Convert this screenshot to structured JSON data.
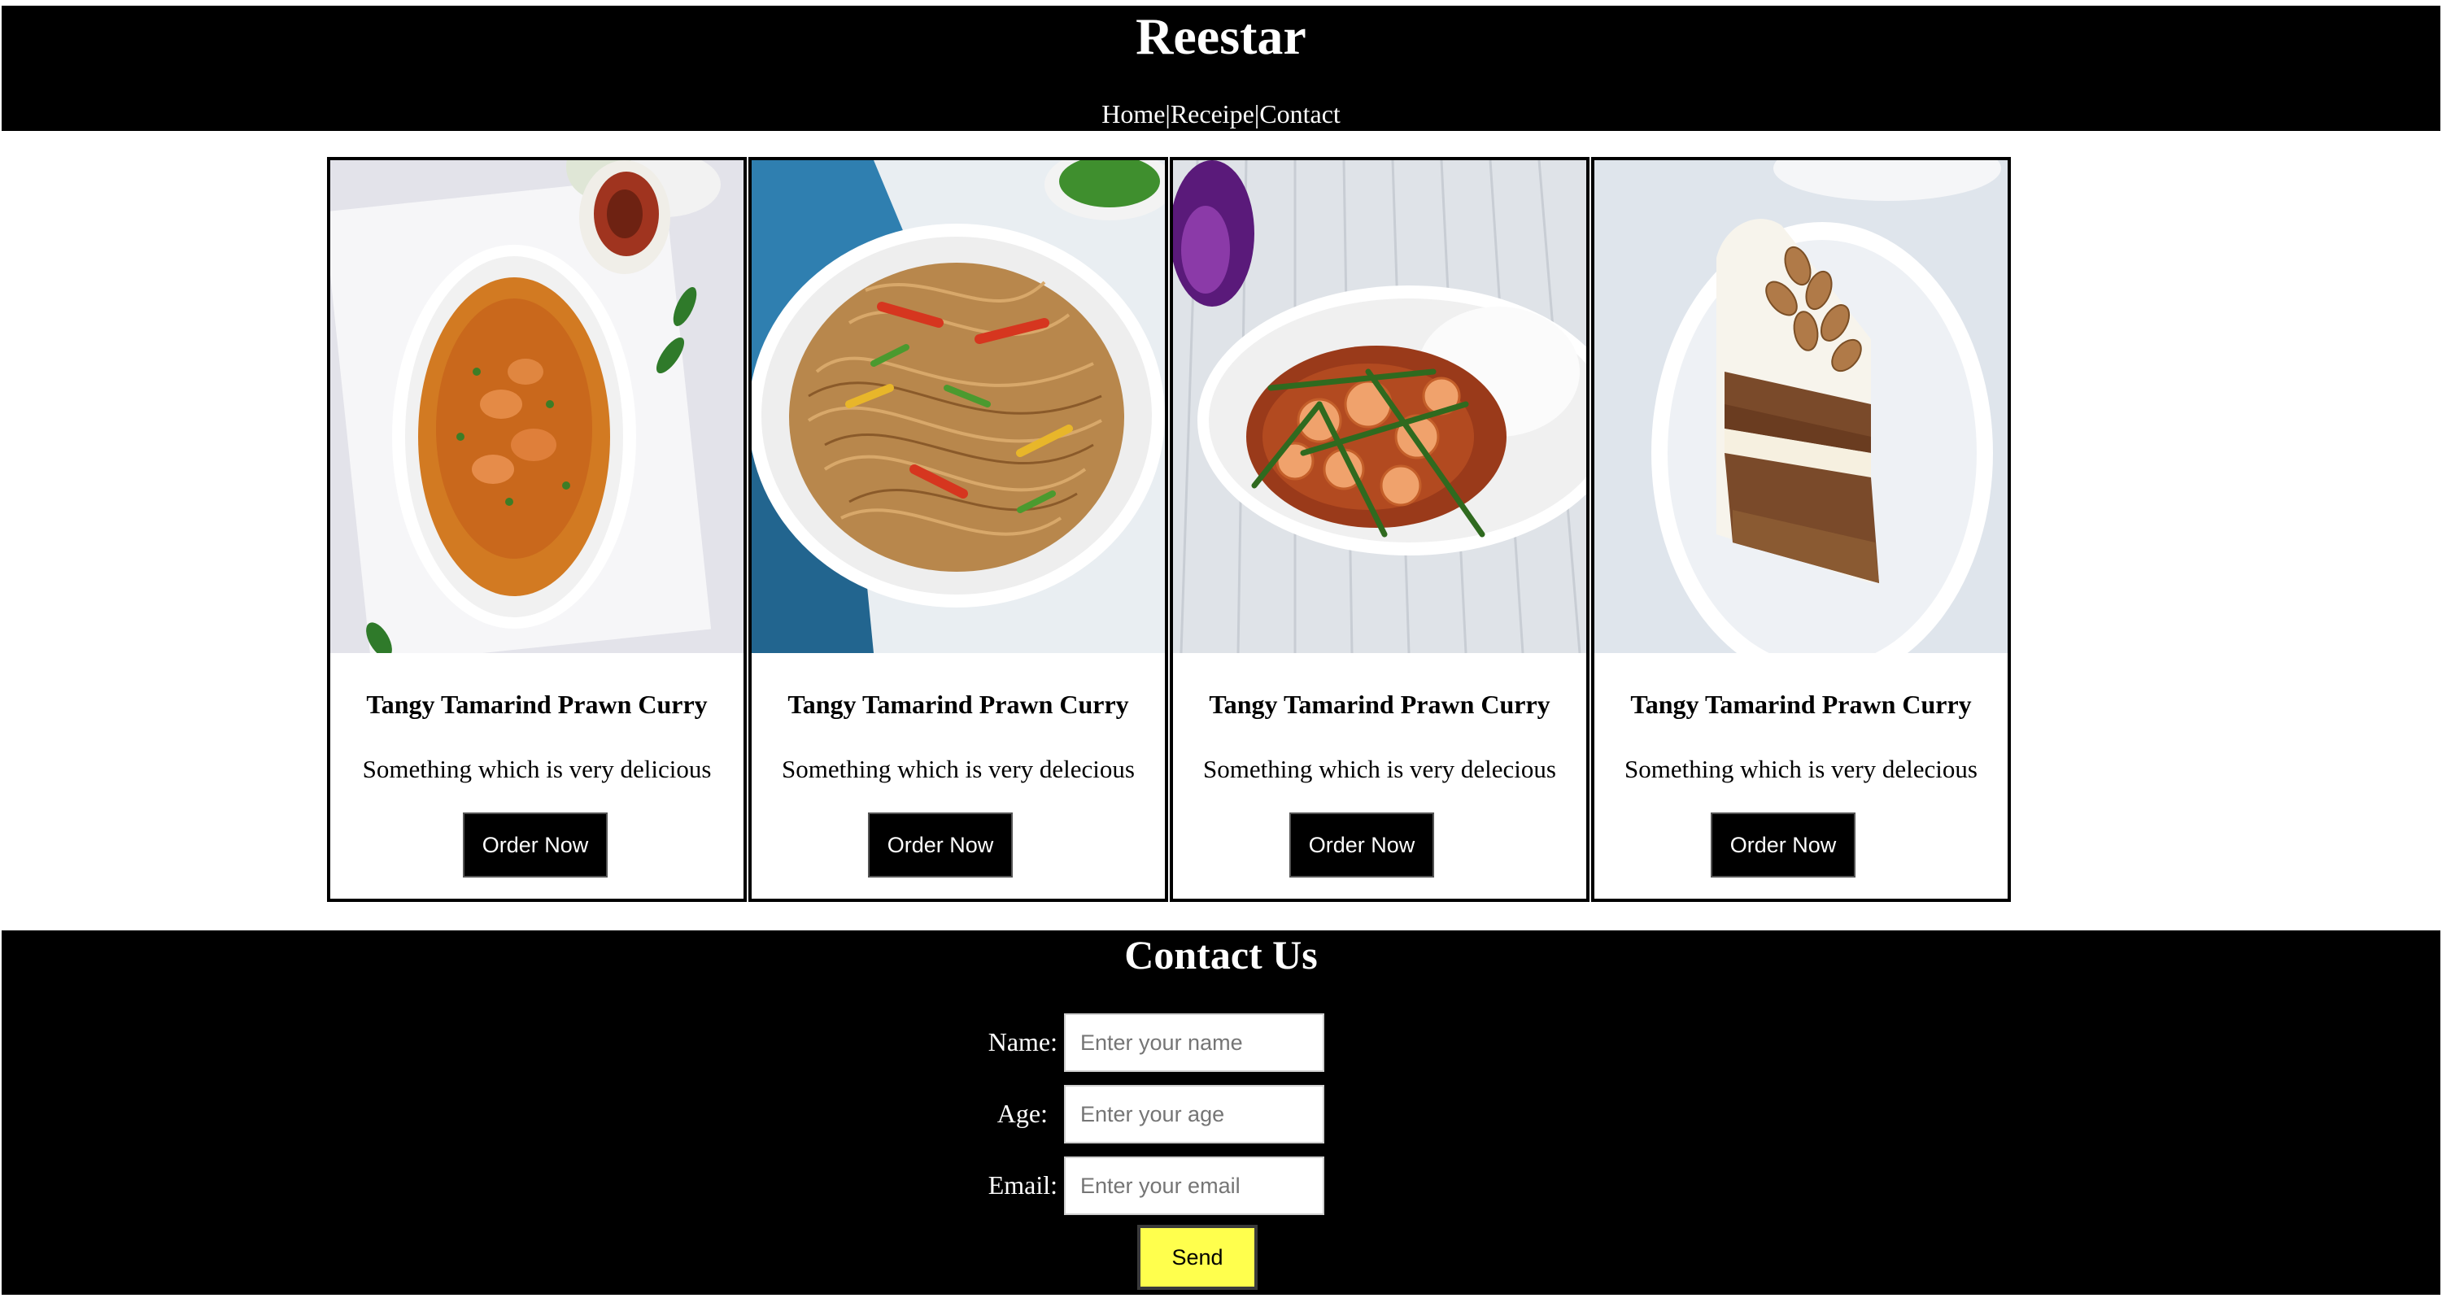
{
  "site": {
    "title": "Reestar"
  },
  "nav": {
    "items": [
      {
        "label": "Home"
      },
      {
        "label": "Receipe"
      },
      {
        "label": "Contact"
      }
    ],
    "separator": "|"
  },
  "cards": [
    {
      "image": "prawn-curry-bowl",
      "title": "Tangy Tamarind Prawn Curry",
      "description": "Something which is very delicious",
      "button_label": "Order Now"
    },
    {
      "image": "hakka-noodles-plate",
      "title": "Tangy Tamarind Prawn Curry",
      "description": "Something which is very delecious",
      "button_label": "Order Now"
    },
    {
      "image": "prawns-green-beans-rice",
      "title": "Tangy Tamarind Prawn Curry",
      "description": "Something which is very delecious",
      "button_label": "Order Now"
    },
    {
      "image": "carrot-cake-slice",
      "title": "Tangy Tamarind Prawn Curry",
      "description": "Something which is very delecious",
      "button_label": "Order Now"
    }
  ],
  "contact": {
    "title": "Contact Us",
    "fields": {
      "name": {
        "label": "Name:",
        "placeholder": "Enter your name",
        "value": ""
      },
      "age": {
        "label": "Age:",
        "placeholder": "Enter your age",
        "value": ""
      },
      "email": {
        "label": "Email:",
        "placeholder": "Enter your email",
        "value": ""
      }
    },
    "send_label": "Send"
  },
  "colors": {
    "header_bg": "#000000",
    "text_light": "#ffffff",
    "button_bg": "#000000",
    "send_button_bg": "#ffff4d"
  }
}
